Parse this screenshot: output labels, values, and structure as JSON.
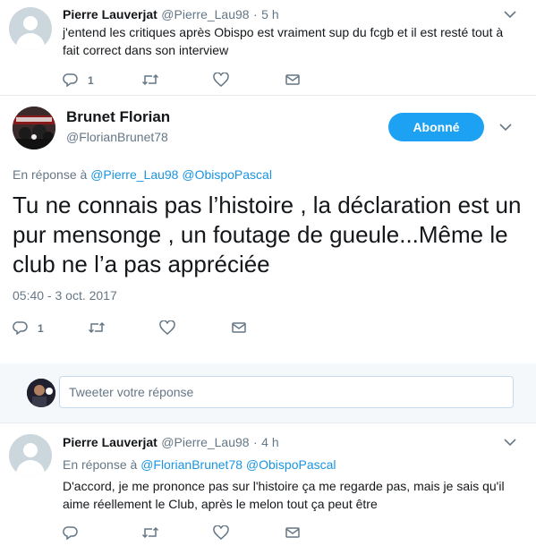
{
  "tweet_top": {
    "name": "Pierre Lauverjat",
    "handle": "@Pierre_Lau98",
    "separator": "·",
    "time": "5 h",
    "text": "j'entend les critiques après Obispo est vraiment sup du fcgb et il est resté tout à fait correct dans son interview",
    "reply_count": "1",
    "icons": [
      "reply-icon",
      "retweet-icon",
      "like-icon",
      "dm-icon",
      "chevron-down-icon"
    ]
  },
  "main_tweet": {
    "name": "Brunet Florian",
    "handle": "@FlorianBrunet78",
    "follow_label": "Abonné",
    "replying_prefix": "En réponse à",
    "replying_to": [
      "@Pierre_Lau98",
      "@ObispoPascal"
    ],
    "text": "Tu ne connais pas l’histoire , la déclaration est un pur mensonge , un foutage de gueule...Même le club ne l’a pas appréciée",
    "timestamp": "05:40 - 3 oct. 2017",
    "reply_count": "1"
  },
  "reply_composer": {
    "placeholder": "Tweeter votre réponse"
  },
  "tweet_bottom": {
    "name": "Pierre Lauverjat",
    "handle": "@Pierre_Lau98",
    "separator": "·",
    "time": "4 h",
    "replying_prefix": "En réponse à",
    "replying_to": [
      "@FlorianBrunet78",
      "@ObispoPascal"
    ],
    "text": "D'accord, je me prononce pas sur l'histoire ça me regarde pas, mais je sais qu'il aime réellement le Club, après le melon tout ça peut être"
  },
  "colors": {
    "accent": "#1da1f2",
    "link": "#1b95e0",
    "muted": "#657786",
    "divider": "#e6ecf0"
  }
}
